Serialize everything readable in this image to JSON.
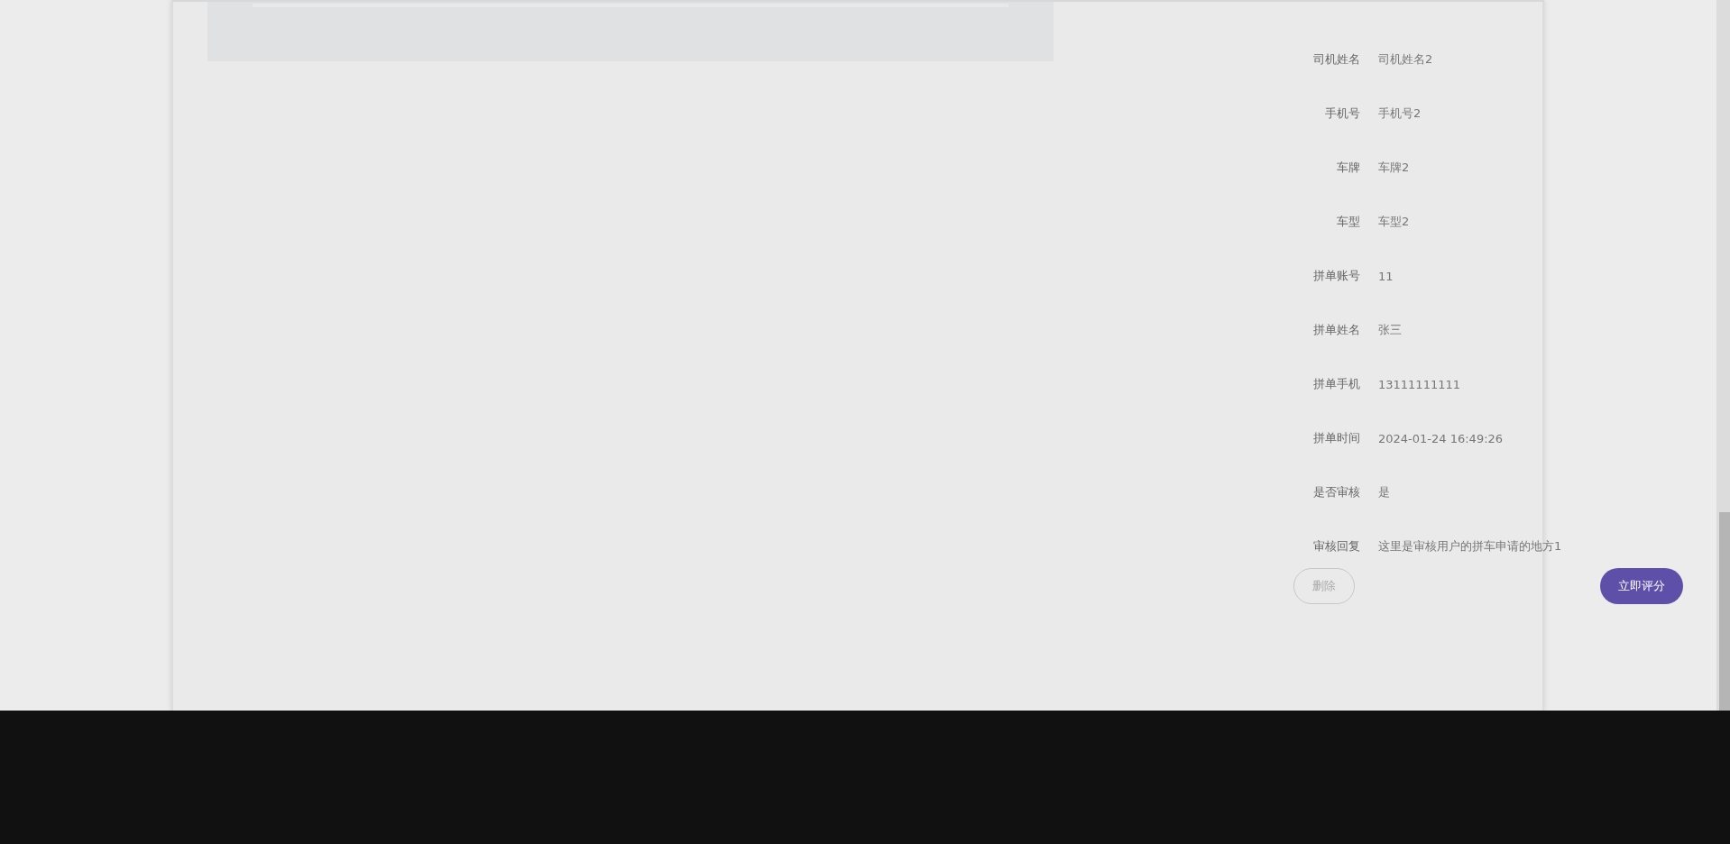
{
  "details": [
    {
      "label": "司机姓名",
      "value": "司机姓名2"
    },
    {
      "label": "手机号",
      "value": "手机号2"
    },
    {
      "label": "车牌",
      "value": "车牌2"
    },
    {
      "label": "车型",
      "value": "车型2"
    },
    {
      "label": "拼单账号",
      "value": "11"
    },
    {
      "label": "拼单姓名",
      "value": "张三"
    },
    {
      "label": "拼单手机",
      "value": "13111111111"
    },
    {
      "label": "拼单时间",
      "value": "2024-01-24 16:49:26"
    },
    {
      "label": "是否审核",
      "value": "是"
    },
    {
      "label": "审核回复",
      "value": "这里是审核用户的拼车申请的地方1"
    }
  ],
  "actions": [
    {
      "label": "删除",
      "kind": "outline"
    },
    {
      "label": "立即评分",
      "kind": "primary"
    }
  ]
}
